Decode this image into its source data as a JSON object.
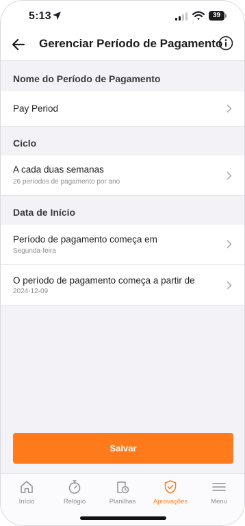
{
  "status_bar": {
    "time": "5:13",
    "battery": "39"
  },
  "header": {
    "title": "Gerenciar Período de Pagamento",
    "back_icon": "back-arrow-icon",
    "info_icon": "info-icon"
  },
  "sections": [
    {
      "title": "Nome do Período de Pagamento",
      "rows": [
        {
          "label": "Pay Period",
          "sub": ""
        }
      ]
    },
    {
      "title": "Ciclo",
      "rows": [
        {
          "label": "A cada duas semanas",
          "sub": "26 períodos de pagamento por ano"
        }
      ]
    },
    {
      "title": "Data de Início",
      "rows": [
        {
          "label": "Período de pagamento começa em",
          "sub": "Segunda-feira"
        },
        {
          "label": "O período de pagamento começa a partir de",
          "sub": "2024-12-09"
        }
      ]
    }
  ],
  "save_label": "Salvar",
  "tabs": [
    {
      "label": "Início",
      "icon": "home-icon"
    },
    {
      "label": "Relógio",
      "icon": "stopwatch-icon"
    },
    {
      "label": "Planilhas",
      "icon": "timesheet-icon"
    },
    {
      "label": "Aprovações",
      "icon": "shield-check-icon",
      "active": true
    },
    {
      "label": "Menu",
      "icon": "hamburger-menu-icon"
    }
  ],
  "colors": {
    "accent": "#ff7a1a",
    "background": "#f2f2f7",
    "text": "#1c1c1e",
    "muted": "#8e8e93"
  }
}
